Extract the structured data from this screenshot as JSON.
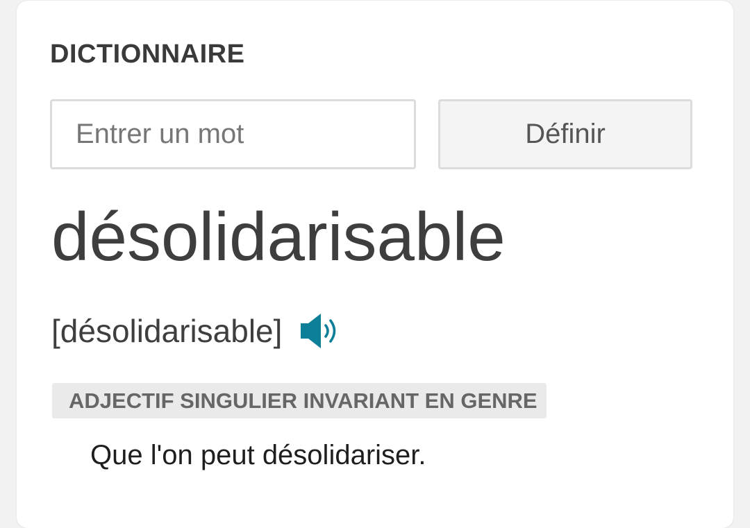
{
  "section": {
    "title": "DICTIONNAIRE"
  },
  "search": {
    "value": "",
    "placeholder": "Entrer un mot",
    "button_label": "Définir"
  },
  "entry": {
    "headword": "désolidarisable",
    "pronunciation": "[désolidarisable]",
    "audio_icon": "speaker-icon",
    "part_of_speech": "ADJECTIF SINGULIER INVARIANT EN GENRE",
    "definitions": [
      "Que l'on peut désolidariser."
    ]
  },
  "colors": {
    "accent": "#0e7f99",
    "text": "#3e3e3e",
    "badge_bg": "#eaeaea",
    "page_bg": "#f2f2f2"
  }
}
